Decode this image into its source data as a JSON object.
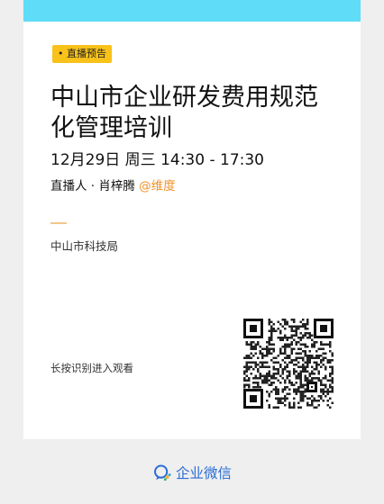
{
  "badge": "• 直播预告",
  "title": "中山市企业研发费用规范化管理培训",
  "time": "12月29日 周三 14:30 - 17:30",
  "host": {
    "prefix": "直播人 · 肖梓腾",
    "org": "@维度"
  },
  "organizer": "中山市科技局",
  "hint": "长按识别进入观看",
  "footer": {
    "brand": "企业微信",
    "icon": "wecom-logo-icon"
  },
  "colors": {
    "top_band": "#5fdcf7",
    "badge_bg": "#f9c21a",
    "accent_org": "#f0912a",
    "brand_blue": "#2b6dd6"
  }
}
